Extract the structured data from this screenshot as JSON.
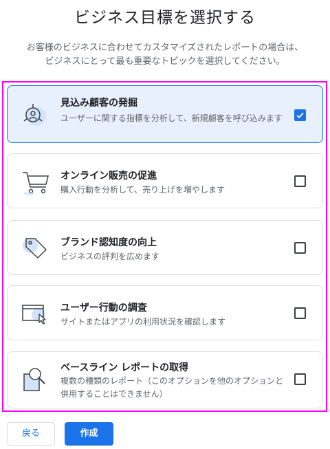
{
  "header": {
    "title": "ビジネス目標を選択する",
    "subtitle_line1": "お客様のビジネスに合わせてカスタマイズされたレポートの場合は、",
    "subtitle_line2": "ビジネスにとって最も重要なトピックを選択してください。"
  },
  "options": [
    {
      "title": "見込み顧客の発掘",
      "description": "ユーザーに関する指標を分析して、新規顧客を呼び込みます",
      "checked": true,
      "icon": "lead-target-icon"
    },
    {
      "title": "オンライン販売の促進",
      "description": "購入行動を分析して、売り上げを増やします",
      "checked": false,
      "icon": "shopping-cart-icon"
    },
    {
      "title": "ブランド認知度の向上",
      "description": "ビジネスの評判を広めます",
      "checked": false,
      "icon": "price-tag-icon"
    },
    {
      "title": "ユーザー行動の調査",
      "description": "サイトまたはアプリの利用状況を確認します",
      "checked": false,
      "icon": "cursor-window-icon"
    },
    {
      "title": "ベースライン レポートの取得",
      "description": "複数の種類のレポート（このオプションを他のオプションと併用することはできません）",
      "checked": false,
      "icon": "document-magnifier-icon"
    }
  ],
  "footer": {
    "back_label": "戻る",
    "create_label": "作成"
  },
  "colors": {
    "accent": "#1a73e8",
    "selected_bg": "#e8f0fe",
    "highlight_frame": "#ff00ff",
    "icon_blob": "#d2e3fc"
  }
}
